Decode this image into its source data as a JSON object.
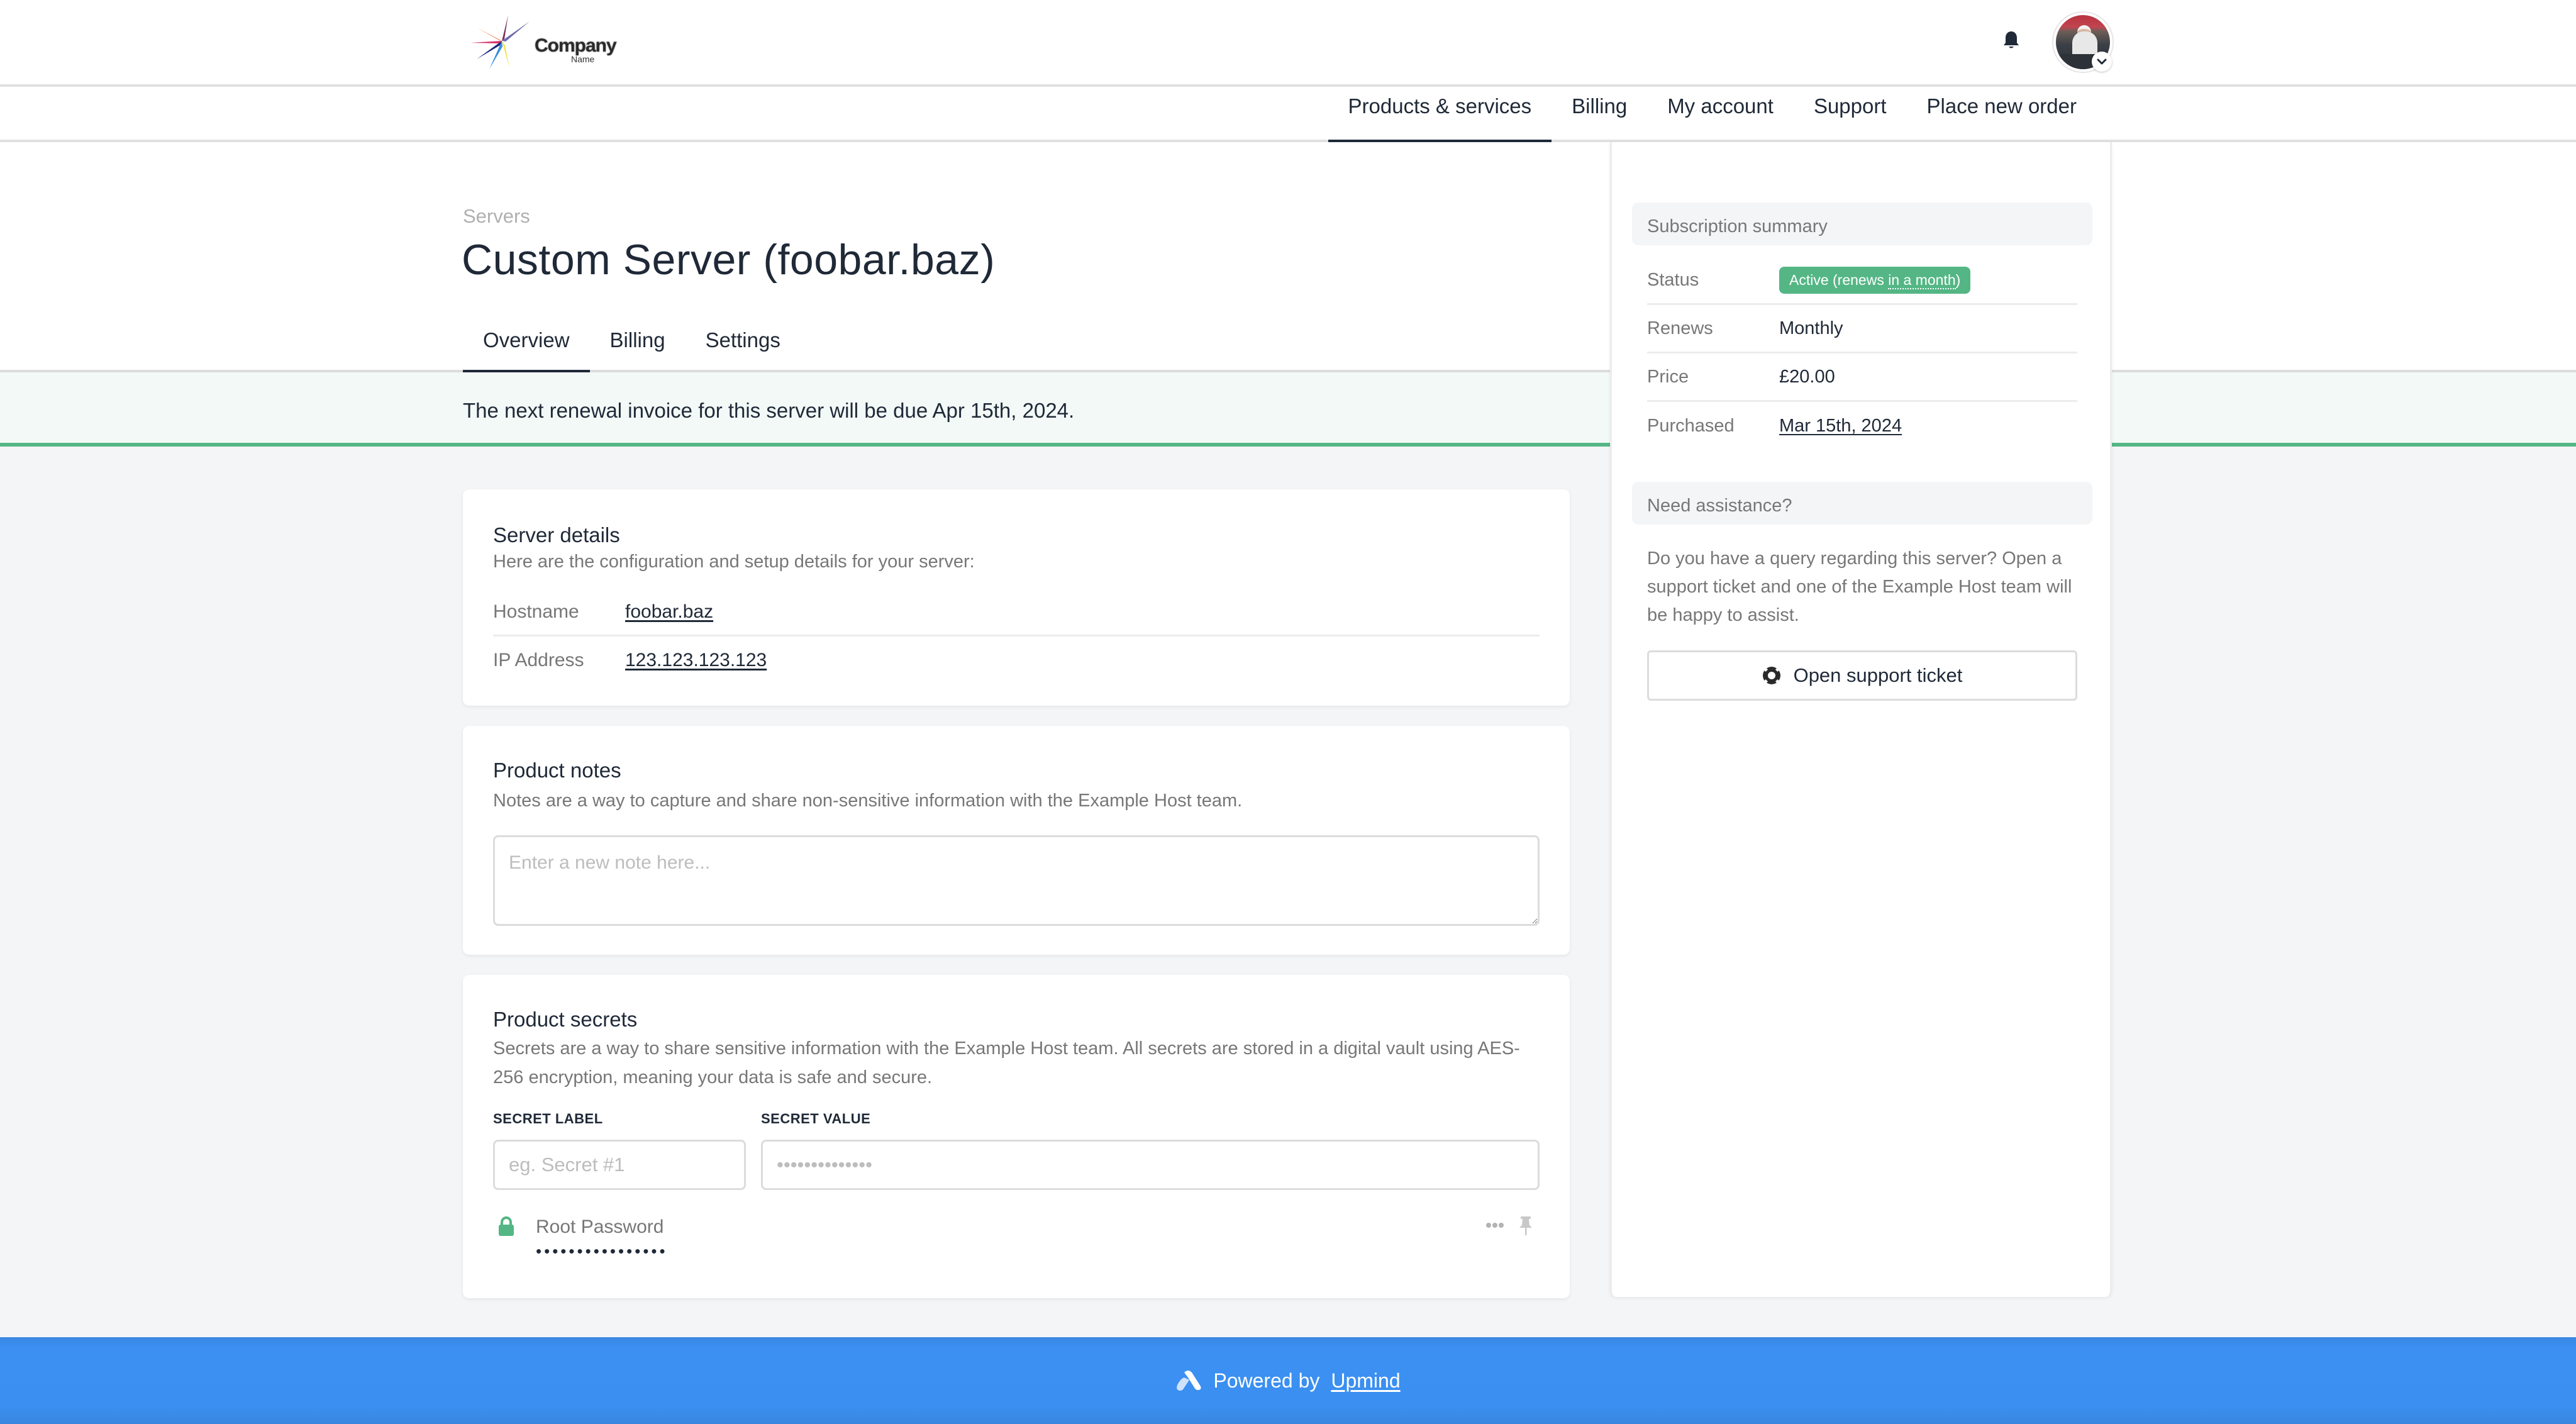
{
  "header": {
    "logo": {
      "primary": "Company",
      "secondary": "Name"
    },
    "notifications_icon": "bell-icon",
    "avatar_chevron_icon": "chevron-down-icon"
  },
  "nav": {
    "items": [
      {
        "label": "Products & services",
        "active": true
      },
      {
        "label": "Billing",
        "active": false
      },
      {
        "label": "My account",
        "active": false
      },
      {
        "label": "Support",
        "active": false
      },
      {
        "label": "Place new order",
        "active": false
      }
    ]
  },
  "page": {
    "breadcrumb": "Servers",
    "title": "Custom Server (foobar.baz)",
    "tabs": [
      {
        "label": "Overview",
        "active": true
      },
      {
        "label": "Billing",
        "active": false
      },
      {
        "label": "Settings",
        "active": false
      }
    ]
  },
  "banner": {
    "text": "The next renewal invoice for this server will be due Apr 15th, 2024."
  },
  "server_details": {
    "title": "Server details",
    "description": "Here are the configuration and setup details for your server:",
    "rows": [
      {
        "label": "Hostname",
        "value": "foobar.baz"
      },
      {
        "label": "IP Address",
        "value": "123.123.123.123"
      }
    ]
  },
  "product_notes": {
    "title": "Product notes",
    "description": "Notes are a way to capture and share non-sensitive information with the Example Host team.",
    "placeholder": "Enter a new note here...",
    "value": ""
  },
  "product_secrets": {
    "title": "Product secrets",
    "description": "Secrets are a way to share sensitive information with the Example Host team. All secrets are stored in a digital vault using AES-256 encryption, meaning your data is safe and secure.",
    "label_field": {
      "label": "SECRET LABEL",
      "placeholder": "eg. Secret #1"
    },
    "value_field": {
      "label": "SECRET VALUE",
      "placeholder": "••••••••••••••"
    },
    "secrets": [
      {
        "name": "Root Password",
        "masked_value": "••••••••••••••••"
      }
    ]
  },
  "subscription": {
    "title": "Subscription summary",
    "status_label": "Status",
    "status_prefix": "Active (renews ",
    "status_relative": "in a month",
    "status_suffix": ")",
    "status_color": "#54b685",
    "renews_label": "Renews",
    "renews_value": "Monthly",
    "price_label": "Price",
    "price_value": "£20.00",
    "purchased_label": "Purchased",
    "purchased_value": "Mar 15th, 2024"
  },
  "assistance": {
    "title": "Need assistance?",
    "text": "Do you have a query regarding this server? Open a support ticket and one of the Example Host team will be happy to assist.",
    "button_label": "Open support ticket"
  },
  "footer": {
    "prefix": "Powered by",
    "link": "Upmind",
    "color": "#3b8ff0"
  }
}
